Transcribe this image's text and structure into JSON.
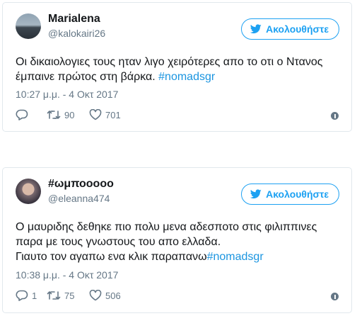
{
  "tweets": [
    {
      "name": "Marialena",
      "handle": "@kalokairi26",
      "follow_label": "Ακολουθήστε",
      "text_line1": "Οι δικαιολογιες τους ηταν λιγο χειρότερες απο το οτι ο Ντανος",
      "text_line2_plain": "έμπαινε πρώτος στη βάρκα. ",
      "hashtag": "#nomadsgr",
      "timestamp": "10:27 μ.μ. - 4 Οκτ 2017",
      "replies": "",
      "retweets": "90",
      "likes": "701"
    },
    {
      "name": "#ωμποοοοο",
      "handle": "@eleanna474",
      "follow_label": "Ακολουθήστε",
      "text_line1": "Ο μαυριδης δεθηκε πιο πολυ μενα αδεσποτο στις φιλιππινες",
      "text_line2": "παρα με τους γνωστους του απο ελλαδα.",
      "text_line3_plain": "Γιαυτο τον αγαπω ενα κλικ παραπανω",
      "hashtag": "#nomadsgr",
      "timestamp": "10:38 μ.μ. - 4 Οκτ 2017",
      "replies": "1",
      "retweets": "75",
      "likes": "506"
    }
  ],
  "icons": {
    "bird": "twitter-bird-icon",
    "reply": "reply-icon",
    "retweet": "retweet-icon",
    "like": "heart-icon",
    "info": "info-icon"
  },
  "colors": {
    "accent": "#1da1f2",
    "hashtag": "#1b95e0",
    "muted": "#657786",
    "border": "#e1e8ed"
  }
}
